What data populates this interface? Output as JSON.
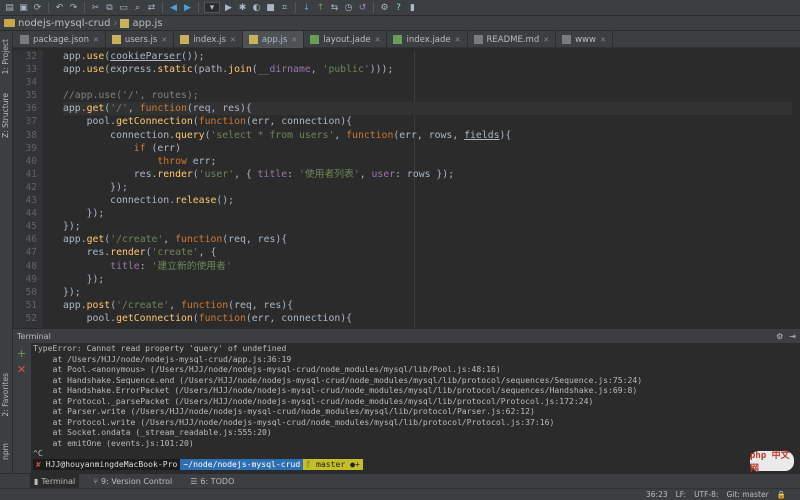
{
  "toolbar": {
    "icons": [
      "open-folder",
      "save",
      "sync",
      "undo",
      "redo",
      "cut",
      "copy",
      "paste",
      "find",
      "replace",
      "back",
      "forward",
      "run-config",
      "run",
      "debug",
      "coverage",
      "stop",
      "build",
      "vcs-update",
      "vcs-commit",
      "vcs-compare",
      "vcs-history",
      "vcs-revert",
      "settings",
      "help",
      "terminal-tool"
    ]
  },
  "breadcrumb": {
    "project": "nodejs-mysql-crud",
    "file": "app.js"
  },
  "tabs": [
    "package.json",
    "users.js",
    "index.js",
    "app.js",
    "layout.jade",
    "index.jade",
    "README.md",
    "www"
  ],
  "active_tab": "app.js",
  "left_tools": {
    "project": "1: Project",
    "structure": "Z: Structure",
    "favorites": "2: Favorites",
    "npm": "npm"
  },
  "gutter": [
    "32",
    "33",
    "34",
    "35",
    "36",
    "37",
    "38",
    "39",
    "40",
    "41",
    "42",
    "43",
    "44",
    "45",
    "46",
    "47",
    "48",
    "49",
    "50",
    "51",
    "52"
  ],
  "terminal": {
    "title": "Terminal",
    "lines": [
      "TypeError: Cannot read property 'query' of undefined",
      "    at /Users/HJJ/node/nodejs-mysql-crud/app.js:36:19",
      "    at Pool.<anonymous> (/Users/HJJ/node/nodejs-mysql-crud/node_modules/mysql/lib/Pool.js:48:16)",
      "    at Handshake.Sequence.end (/Users/HJJ/node/nodejs-mysql-crud/node_modules/mysql/lib/protocol/sequences/Sequence.js:75:24)",
      "    at Handshake.ErrorPacket (/Users/HJJ/node/nodejs-mysql-crud/node_modules/mysql/lib/protocol/sequences/Handshake.js:69:8)",
      "    at Protocol._parsePacket (/Users/HJJ/node/nodejs-mysql-crud/node_modules/mysql/lib/protocol/Protocol.js:172:24)",
      "    at Parser.write (/Users/HJJ/node/nodejs-mysql-crud/node_modules/mysql/lib/protocol/Parser.js:62:12)",
      "    at Protocol.write (/Users/HJJ/node/nodejs-mysql-crud/node_modules/mysql/lib/protocol/Protocol.js:37:16)",
      "    at Socket.ondata (_stream_readable.js:555:20)",
      "    at emitOne (events.js:101:20)",
      "^C"
    ],
    "prompt_user": "HJJ@houyanmingdeMacBook-Pro",
    "prompt_path": "~/node/nodejs-mysql-crud",
    "prompt_branch": "master ●+"
  },
  "bottom_tabs": {
    "terminal": "Terminal",
    "vcs": "9: Version Control",
    "todo": "6: TODO"
  },
  "status": {
    "position": "36:23",
    "line_sep": "LF:",
    "encoding": "UTF-8:",
    "git": "Git: master"
  },
  "watermark": "php 中文网"
}
